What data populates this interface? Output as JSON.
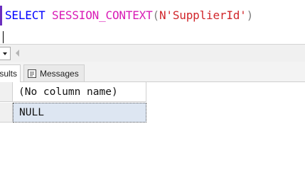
{
  "editor": {
    "query": {
      "keyword": "SELECT",
      "function": "SESSION_CONTEXT",
      "open_paren": "(",
      "string_literal": "N'SupplierId'",
      "close_paren": ")"
    }
  },
  "result_tabs": {
    "results_label": "sults",
    "messages_label": "Messages"
  },
  "grid": {
    "columns": [
      "(No column name)"
    ],
    "rows": [
      [
        "NULL"
      ]
    ]
  },
  "colors": {
    "keyword": "#0000ff",
    "function": "#d81bb5",
    "punctuation": "#808080",
    "string": "#d1262b",
    "selected_cell": "#dde6f2"
  }
}
